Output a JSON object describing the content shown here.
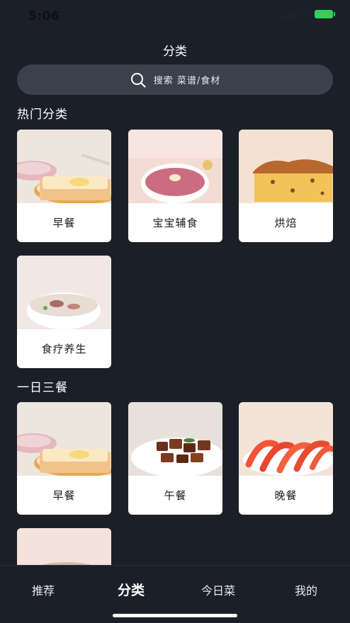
{
  "status_bar": {
    "time": "5:06",
    "battery_color": "#2fd158"
  },
  "header": {
    "title": "分类"
  },
  "search": {
    "placeholder": "搜索 菜谱/食材",
    "icon": "search-icon"
  },
  "hot_categories": {
    "title": "热门分类",
    "items": [
      {
        "label": "早餐",
        "image": "toast-breakfast-photo"
      },
      {
        "label": "宝宝辅食",
        "image": "pink-porridge-photo"
      },
      {
        "label": "烘焙",
        "image": "pound-cake-photo"
      },
      {
        "label": "食疗养生",
        "image": "congee-bowl-photo"
      }
    ]
  },
  "three_meals": {
    "title": "一日三餐",
    "items": [
      {
        "label": "早餐",
        "image": "toast-breakfast-photo"
      },
      {
        "label": "午餐",
        "image": "braised-pork-photo"
      },
      {
        "label": "晚餐",
        "image": "shrimp-dish-photo"
      }
    ]
  },
  "bottom_nav": {
    "items": [
      {
        "label": "推荐",
        "active": false
      },
      {
        "label": "分类",
        "active": true
      },
      {
        "label": "今日菜",
        "active": false
      },
      {
        "label": "我的",
        "active": false
      }
    ]
  },
  "colors": {
    "background": "#1b1f28",
    "search_bg": "#3a404c",
    "card_bg": "#ffffff"
  }
}
